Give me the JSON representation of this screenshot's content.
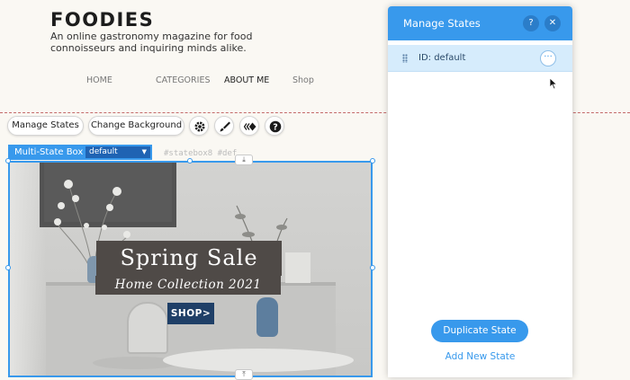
{
  "site": {
    "brand": "FOODIES",
    "tagline": "An online gastronomy magazine for food connoisseurs and inquiring minds alike.",
    "nav": [
      "HOME",
      "CATEGORIES",
      "ABOUT ME",
      "Shop"
    ]
  },
  "toolbar": {
    "manage_states": "Manage States",
    "change_background": "Change Background",
    "icons": [
      "gear-icon",
      "brush-icon",
      "animation-icon",
      "help-icon"
    ]
  },
  "multistate": {
    "label": "Multi-State Box",
    "selected_state": "default",
    "ghost_id": "#statebox8  #def"
  },
  "hero": {
    "headline": "Spring Sale",
    "subheadline": "Home Collection 2021",
    "button": "SHOP>"
  },
  "panel": {
    "title": "Manage States",
    "help": "?",
    "close": "✕",
    "states": [
      {
        "label": "ID: default",
        "more": "···"
      }
    ],
    "duplicate": "Duplicate State",
    "add": "Add New State"
  },
  "colors": {
    "accent": "#3899ec",
    "banner": "#4f4a47",
    "shop_button": "#1f3f67"
  }
}
